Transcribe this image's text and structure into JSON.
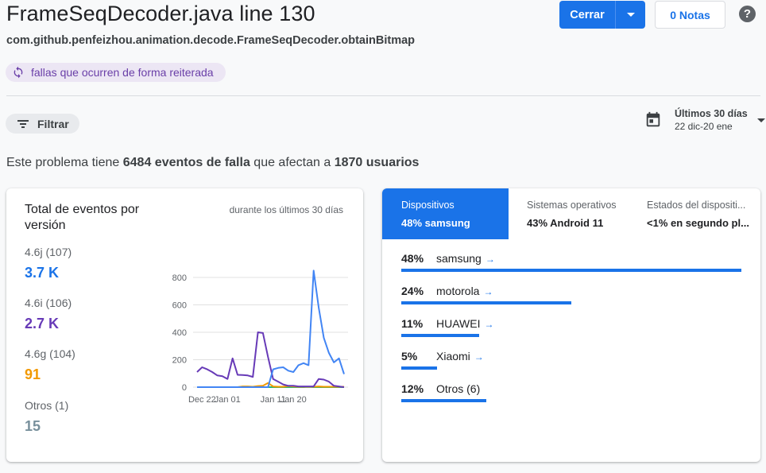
{
  "header": {
    "title": "FrameSeqDecoder.java line 130",
    "subtitle": "com.github.penfeizhou.animation.decode.FrameSeqDecoder.obtainBitmap",
    "chip_label": "fallas que ocurren de forma reiterada",
    "close_label": "Cerrar",
    "notes_label": "0 Notas",
    "help_label": "?"
  },
  "toolbar": {
    "filter_label": "Filtrar",
    "date_range_title": "Últimos 30 días",
    "date_range_value": "22 dic-20 ene"
  },
  "summary": {
    "prefix": "Este problema tiene ",
    "events": "6484 eventos de falla",
    "middle": " que afectan a ",
    "users": "1870 usuarios"
  },
  "versions_card": {
    "title": "Total de eventos por versión",
    "range": "durante los últimos 30 días",
    "versions": [
      {
        "label": "4.6j (107)",
        "value": "3.7 K",
        "color": "#1a73e8"
      },
      {
        "label": "4.6i (106)",
        "value": "2.7 K",
        "color": "#673ab7"
      },
      {
        "label": "4.6g (104)",
        "value": "91",
        "color": "#f29900"
      },
      {
        "label": "Otros (1)",
        "value": "15",
        "color": "#78909c"
      }
    ]
  },
  "chart_data": {
    "type": "line",
    "ylim": [
      0,
      850
    ],
    "yticks": [
      "0",
      "200",
      "400",
      "600",
      "800"
    ],
    "xticks": [
      "Dec 22",
      "Jan 01",
      "Jan 11",
      "Jan 20"
    ],
    "grid": true,
    "series": [
      {
        "name": "4.6j (107)",
        "color": "#4285f4",
        "values": [
          0,
          0,
          0,
          0,
          0,
          0,
          0,
          0,
          0,
          0,
          0,
          0,
          0,
          0,
          0,
          130,
          140,
          145,
          120,
          110,
          160,
          175,
          160,
          850,
          580,
          360,
          250,
          180,
          210,
          95
        ]
      },
      {
        "name": "4.6i (106)",
        "color": "#673ab7",
        "values": [
          110,
          145,
          130,
          110,
          85,
          80,
          60,
          210,
          90,
          88,
          85,
          75,
          400,
          395,
          220,
          60,
          40,
          20,
          10,
          10,
          5,
          5,
          5,
          5,
          60,
          55,
          40,
          10,
          5,
          0
        ]
      },
      {
        "name": "4.6g (104)",
        "color": "#f29900",
        "values": [
          0,
          0,
          0,
          0,
          0,
          0,
          0,
          0,
          0,
          5,
          5,
          3,
          8,
          10,
          30,
          5,
          3,
          3,
          8,
          5,
          3,
          3,
          3,
          3,
          5,
          3,
          3,
          3,
          3,
          3
        ]
      },
      {
        "name": "Otros (1)",
        "color": "#2bb673",
        "values": [
          0,
          0,
          0,
          0,
          0,
          0,
          0,
          0,
          0,
          0,
          0,
          0,
          0,
          0,
          0,
          0,
          0,
          0,
          0,
          0,
          0,
          0,
          2,
          0,
          0,
          0,
          0,
          0,
          0,
          0
        ]
      }
    ]
  },
  "devices_card": {
    "tabs": [
      {
        "label": "Dispositivos",
        "value": "48% samsung",
        "active": true
      },
      {
        "label": "Sistemas operativos",
        "value": "43% Android 11",
        "active": false
      },
      {
        "label": "Estados del dispositi...",
        "value": "<1% en segundo pl...",
        "active": false
      }
    ],
    "rows": [
      {
        "pct": "48%",
        "name": "samsung",
        "share": 100,
        "arrow": "→"
      },
      {
        "pct": "24%",
        "name": "motorola",
        "share": 50,
        "arrow": "→"
      },
      {
        "pct": "11%",
        "name": "HUAWEI",
        "share": 23,
        "arrow": "→"
      },
      {
        "pct": "5%",
        "name": "Xiaomi",
        "share": 11,
        "arrow": "→"
      },
      {
        "pct": "12%",
        "name": "Otros (6)",
        "share": 25,
        "arrow": ""
      }
    ]
  }
}
